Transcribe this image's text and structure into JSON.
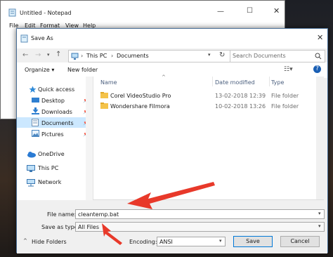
{
  "notepad": {
    "title": "Untitled - Notepad",
    "menu": [
      "File",
      "Edit",
      "Format",
      "View",
      "Help"
    ]
  },
  "dialog": {
    "title": "Save As",
    "breadcrumb": [
      "This PC",
      "Documents"
    ],
    "search_placeholder": "Search Documents",
    "toolbar": {
      "organize": "Organize ▾",
      "new_folder": "New folder"
    },
    "columns": {
      "name": "Name",
      "date": "Date modified",
      "type": "Type"
    },
    "nav": [
      {
        "label": "Quick access"
      },
      {
        "label": "Desktop"
      },
      {
        "label": "Downloads"
      },
      {
        "label": "Documents"
      },
      {
        "label": "Pictures"
      },
      {
        "label": "OneDrive"
      },
      {
        "label": "This PC"
      },
      {
        "label": "Network"
      }
    ],
    "files": [
      {
        "name": "Corel VideoStudio Pro",
        "date": "13-02-2018 12:39",
        "type": "File folder"
      },
      {
        "name": "Wondershare Filmora",
        "date": "10-02-2018 13:26",
        "type": "File folder"
      }
    ],
    "file_name_label": "File name:",
    "file_name_value": "cleantemp.bat",
    "save_type_label": "Save as type:",
    "save_type_value": "All Files",
    "hide_folders": "Hide Folders",
    "encoding_label": "Encoding:",
    "encoding_value": "ANSI",
    "save": "Save",
    "cancel": "Cancel",
    "accent": "#0078d7",
    "arrow_color": "#e8392a"
  }
}
